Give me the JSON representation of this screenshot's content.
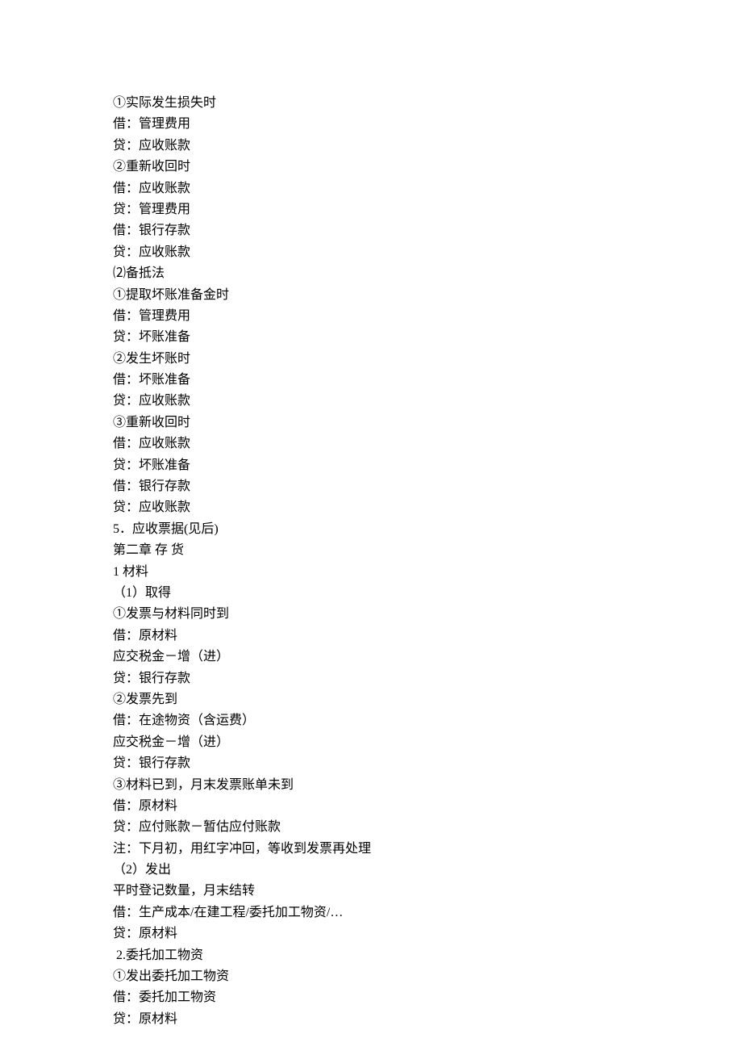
{
  "lines": [
    "①实际发生损失时",
    "借：管理费用",
    "贷：应收账款",
    "②重新收回时",
    "借：应收账款",
    "贷：管理费用",
    "借：银行存款",
    "贷：应收账款",
    "⑵备抵法",
    "①提取坏账准备金时",
    "借：管理费用",
    "贷：坏账准备",
    "②发生坏账时",
    "借：坏账准备",
    "贷：应收账款",
    "③重新收回时",
    "借：应收账款",
    "贷：坏账准备",
    "借：银行存款",
    "贷：应收账款",
    "5．应收票据(见后)",
    "第二章 存 货",
    "1 材料",
    "（1）取得",
    "①发票与材料同时到",
    "借：原材料",
    "应交税金－增（进）",
    "贷：银行存款",
    "②发票先到",
    "借：在途物资（含运费）",
    "应交税金－增（进）",
    "贷：银行存款",
    "③材料已到，月末发票账单未到",
    "借：原材料",
    "贷：应付账款－暂估应付账款",
    "注：下月初，用红字冲回，等收到发票再处理",
    "（2）发出",
    "平时登记数量，月末结转",
    "借：生产成本/在建工程/委托加工物资/…",
    "贷：原材料",
    " 2.委托加工物资",
    "①发出委托加工物资",
    "借：委托加工物资",
    "贷：原材料"
  ]
}
